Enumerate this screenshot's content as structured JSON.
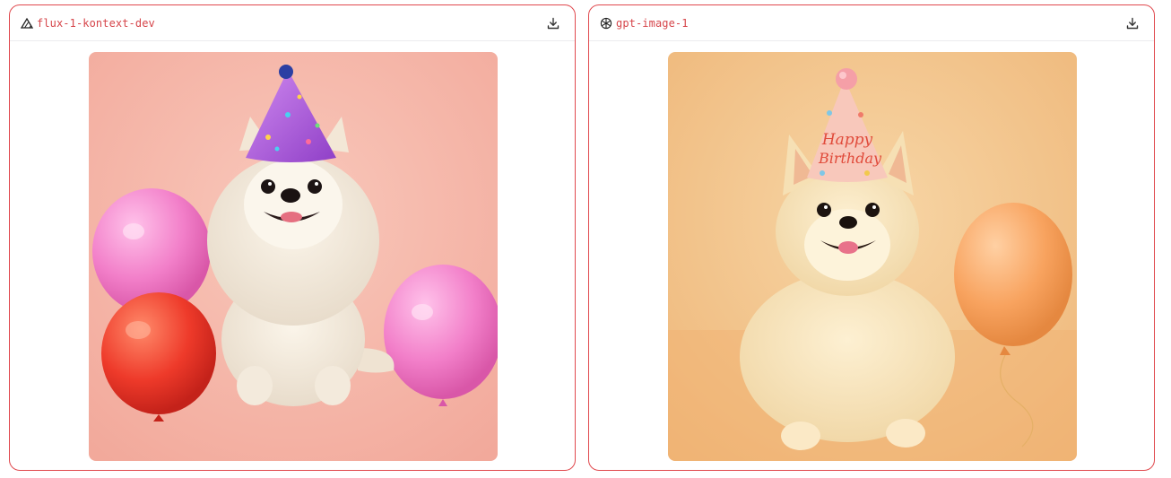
{
  "panels": [
    {
      "model_name": "flux-1-kontext-dev",
      "logo_icon": "flux-triangle-icon",
      "download_icon": "download-icon",
      "image_alt": "",
      "image_palette": {
        "background": "#f6bcae",
        "accent": "#a857d6",
        "balloon_pink": "#f27fc9",
        "balloon_red": "#ee3a2a"
      }
    },
    {
      "model_name": "gpt-image-1",
      "logo_icon": "openai-logo-icon",
      "download_icon": "download-icon",
      "hat_text_line1": "Happy",
      "hat_text_line2": "Birthday",
      "image_palette": {
        "background": "#f3c487",
        "hat": "#f7c4b5",
        "balloon_orange": "#f8a35f"
      }
    }
  ],
  "colors": {
    "border": "#e0484d",
    "model_name": "#d6454a"
  }
}
